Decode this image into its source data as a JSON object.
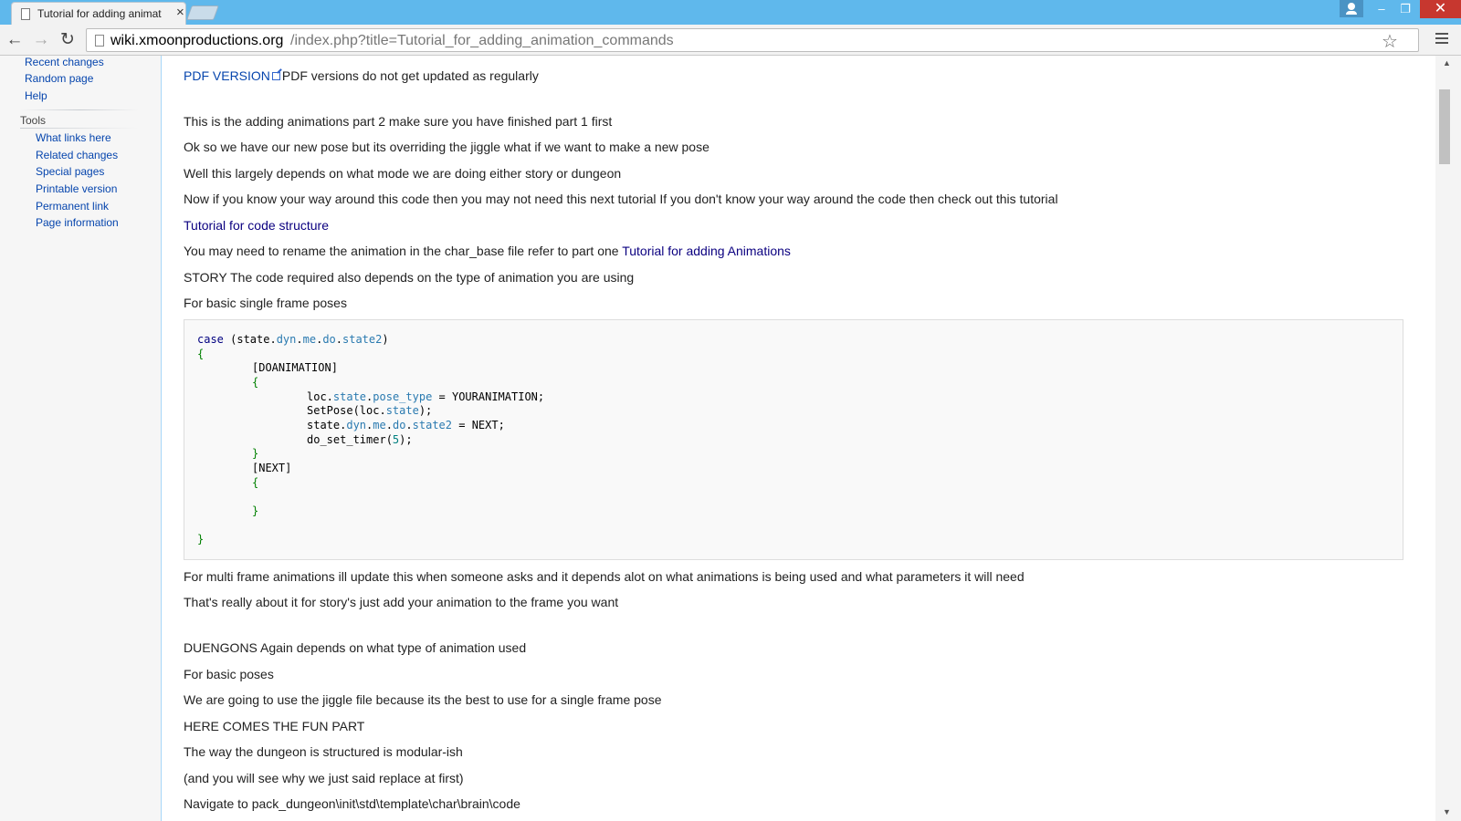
{
  "browser": {
    "tab_title": "Tutorial for adding animat",
    "tab_close": "×",
    "url_host": "wiki.xmoonproductions.org",
    "url_path": "/index.php?title=Tutorial_for_adding_animation_commands",
    "win_min": "–",
    "win_max": "❐",
    "win_close": "✕",
    "back": "←",
    "forward": "→",
    "reload": "↻",
    "star": "☆"
  },
  "sidebar": {
    "nav_links": [
      "Recent changes",
      "Random page",
      "Help"
    ],
    "tools_heading": "Tools",
    "tool_links": [
      "What links here",
      "Related changes",
      "Special pages",
      "Printable version",
      "Permanent link",
      "Page information"
    ]
  },
  "content": {
    "pdf_link": "PDF VERSION",
    "pdf_note": "PDF versions do not get updated as regularly",
    "p1": "This is the adding animations part 2 make sure you have finished part 1 first",
    "p2": "Ok so we have our new pose but its overriding the jiggle what if we want to make a new pose",
    "p3": "Well this largely depends on what mode we are doing either story or dungeon",
    "p4": "Now if you know your way around this code then you may not need this next tutorial If you don't know your way around the code then check out this tutorial",
    "code_structure_link": "Tutorial for code structure",
    "p5_prefix": "You may need to rename the animation in the char_base file refer to part one ",
    "adding_animations_link": "Tutorial for adding Animations",
    "p6": "STORY The code required also depends on the type of animation you are using",
    "p7": "For basic single frame poses",
    "p8": "For multi frame animations ill update this when someone asks and it depends alot on what animations is being used and what parameters it will need",
    "p9": "That's really about it for story's just add your animation to the frame you want",
    "p10": "DUENGONS Again depends on what type of animation used",
    "p11": "For basic poses",
    "p12": "We are going to use the jiggle file because its the best to use for a single frame pose",
    "p13": "HERE COMES THE FUN PART",
    "p14": "The way the dungeon is structured is modular-ish",
    "p15": "(and you will see why we just said replace at first)",
    "p16": "Navigate to pack_dungeon\\init\\std\\template\\char\\brain\\code"
  },
  "code": {
    "case_kw": "case",
    "case_open": " (state.",
    "dyn": "dyn",
    "me": "me",
    "do": "do",
    "state2": "state2",
    "close_paren": ")",
    "brace_open": "{",
    "brace_close": "}",
    "doanimation": "[DOANIMATION]",
    "loc_prefix": "loc.",
    "state": "state",
    "pose_type": "pose_type",
    "assign_anim": " = YOURANIMATION;",
    "setpose_prefix": "SetPose(loc.",
    "setpose_suffix": ");",
    "state_prefix": "state.",
    "assign_next": " = NEXT;",
    "timer_prefix": "do_set_timer(",
    "timer_value": "5",
    "timer_suffix": ");",
    "next_label": "[NEXT]",
    "dot": "."
  }
}
